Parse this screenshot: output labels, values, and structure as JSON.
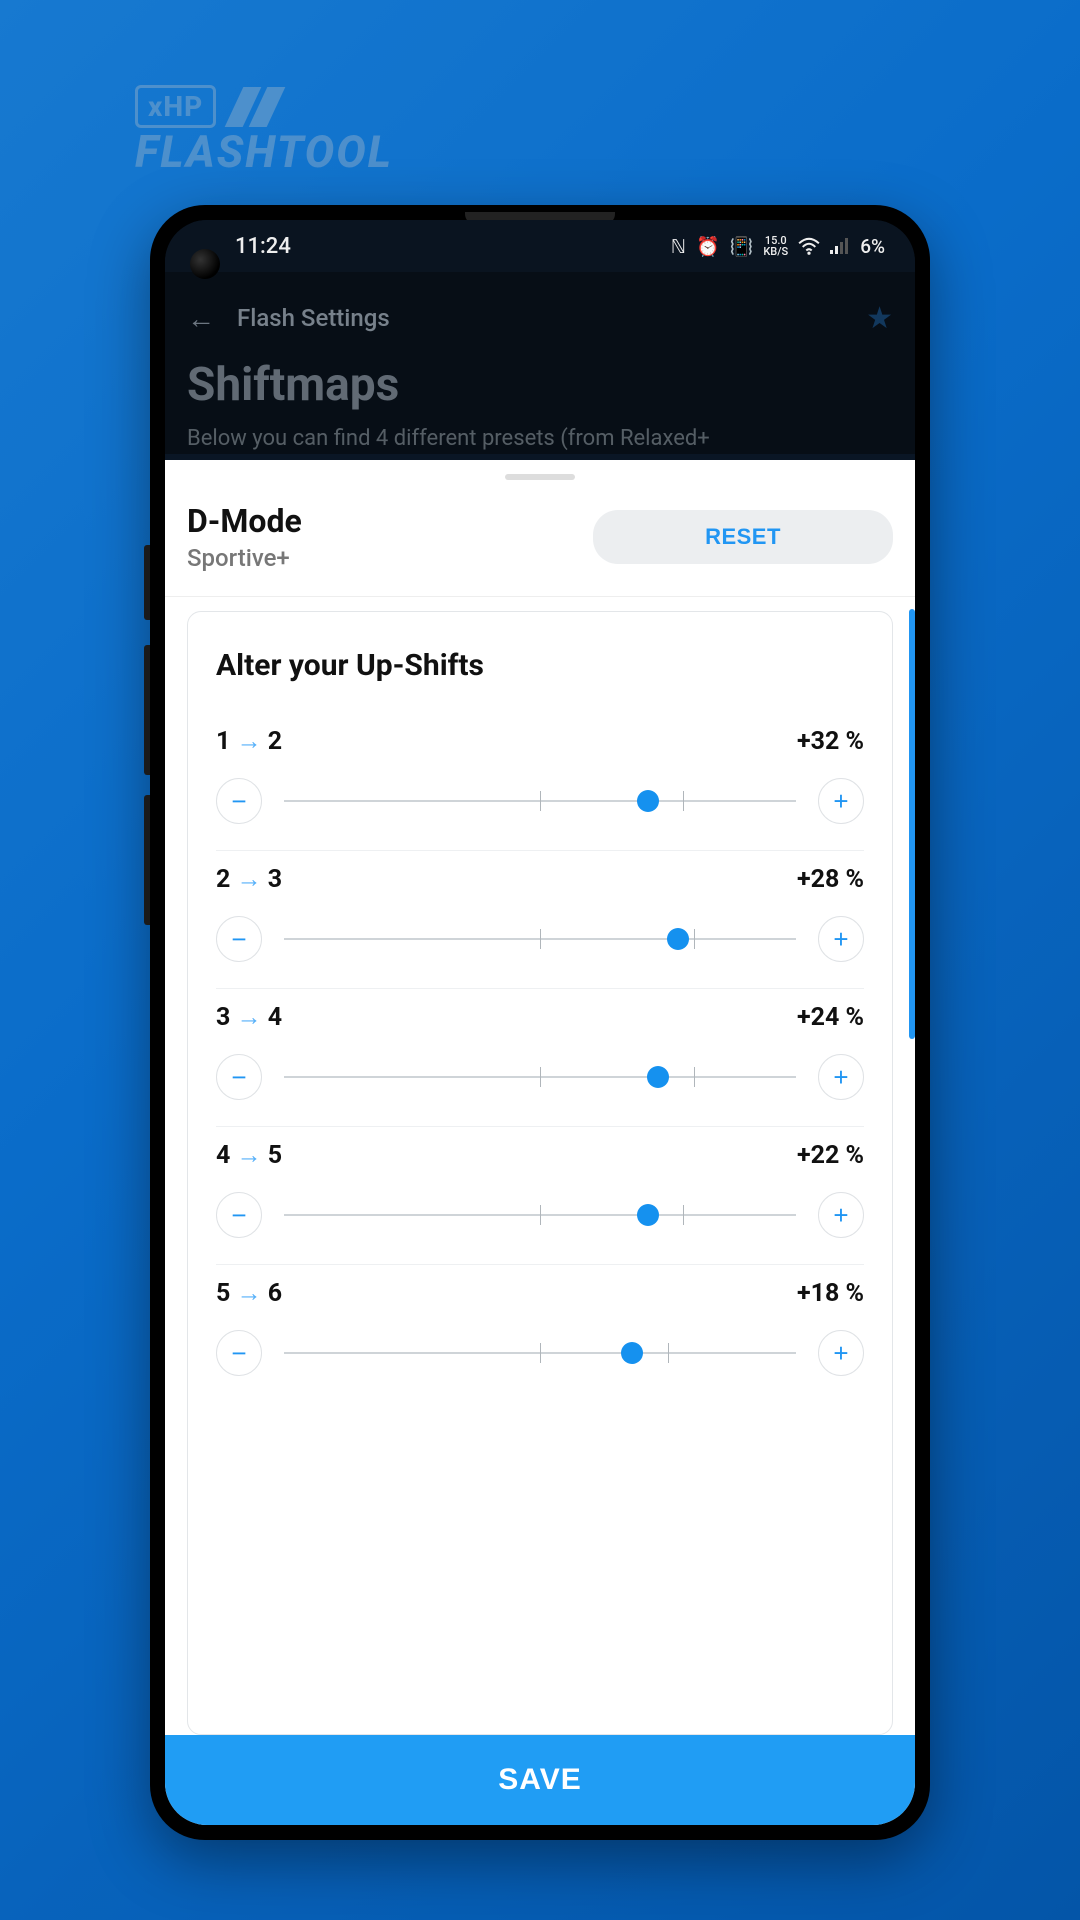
{
  "logo": {
    "badge": "xHP",
    "text": "FLASHTOOL"
  },
  "status": {
    "time": "11:24",
    "speed_value": "15.0",
    "speed_unit": "KB/S",
    "battery": "6%"
  },
  "appbar": {
    "title": "Flash Settings"
  },
  "page": {
    "title": "Shiftmaps",
    "subtitle": "Below you can find 4 different presets (from Relaxed+"
  },
  "sheet": {
    "title": "D-Mode",
    "subtitle": "Sportive+",
    "reset_label": "RESET",
    "card_title": "Alter your Up-Shifts"
  },
  "shifts": [
    {
      "from": "1",
      "to": "2",
      "percent_label": "+32 %",
      "pos": 71,
      "tick1": 50,
      "tick2": 78
    },
    {
      "from": "2",
      "to": "3",
      "percent_label": "+28 %",
      "pos": 77,
      "tick1": 50,
      "tick2": 80
    },
    {
      "from": "3",
      "to": "4",
      "percent_label": "+24 %",
      "pos": 73,
      "tick1": 50,
      "tick2": 80
    },
    {
      "from": "4",
      "to": "5",
      "percent_label": "+22 %",
      "pos": 71,
      "tick1": 50,
      "tick2": 78
    },
    {
      "from": "5",
      "to": "6",
      "percent_label": "+18 %",
      "pos": 68,
      "tick1": 50,
      "tick2": 75
    }
  ],
  "save_label": "SAVE",
  "colors": {
    "accent": "#2196f3"
  }
}
